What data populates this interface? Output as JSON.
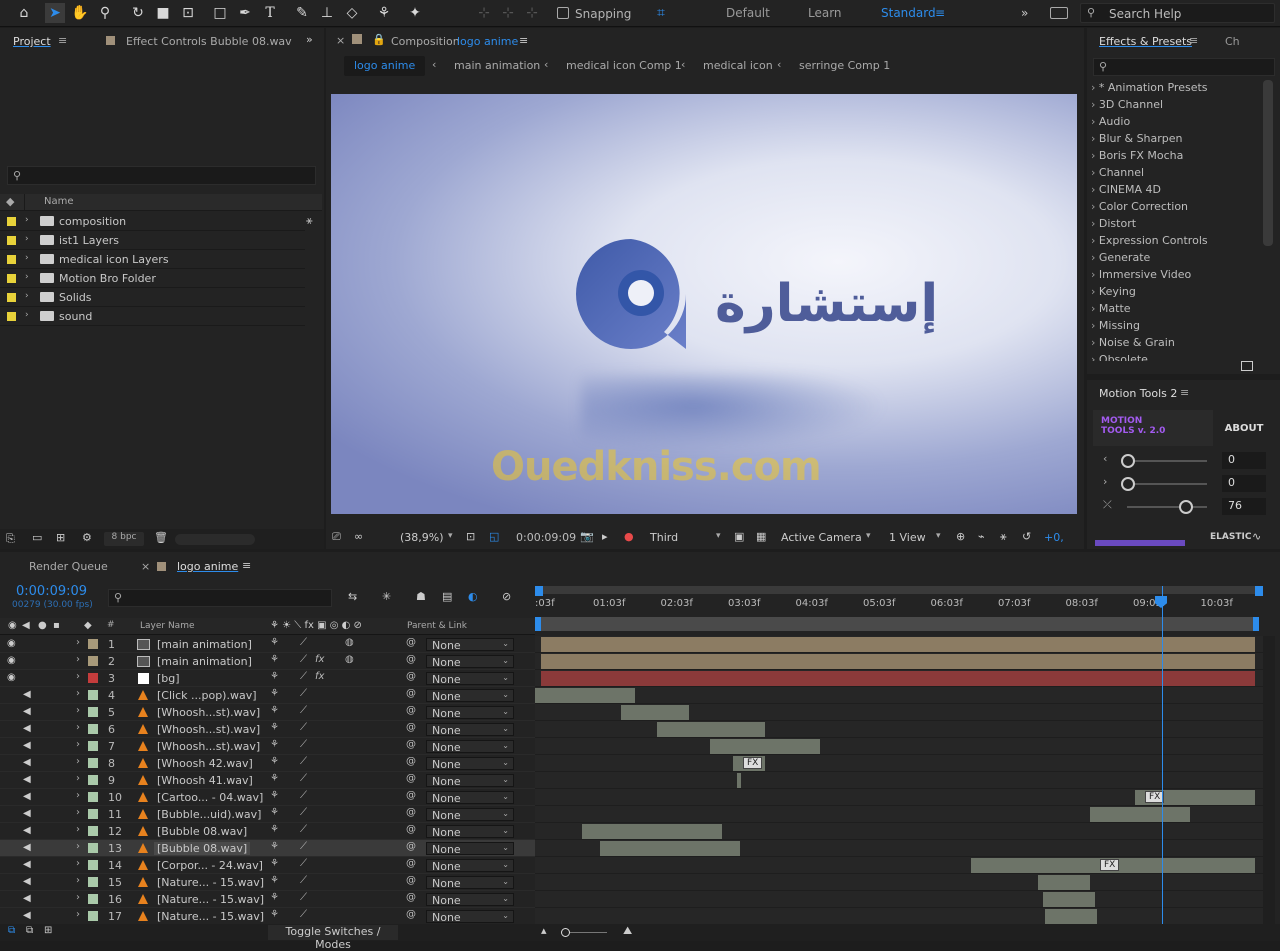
{
  "toolbar": {
    "snapping_label": "Snapping",
    "workspaces": [
      "Default",
      "Learn",
      "Standard"
    ],
    "active_workspace": "Standard",
    "search_placeholder": "Search Help"
  },
  "project_panel": {
    "tab_project": "Project",
    "tab_effect_controls": "Effect Controls  Bubble 08.wav",
    "column_name": "Name",
    "items": [
      {
        "label": "composition",
        "color": "#e8d23a"
      },
      {
        "label": "ist1 Layers",
        "color": "#e8d23a"
      },
      {
        "label": "medical icon Layers",
        "color": "#e8d23a"
      },
      {
        "label": "Motion Bro Folder",
        "color": "#e8d23a"
      },
      {
        "label": "Solids",
        "color": "#e8d23a"
      },
      {
        "label": "sound",
        "color": "#e8d23a"
      }
    ],
    "bpc": "8 bpc"
  },
  "composition": {
    "tab_prefix": "Composition",
    "tab_name": "logo anime",
    "breadcrumbs": [
      "logo anime",
      "main animation",
      "medical icon Comp 1",
      "medical icon",
      "serringe  Comp 1"
    ],
    "logo_text": "إستشارة",
    "watermark": "Ouedkniss.com",
    "zoom": "(38,9%)",
    "timecode": "0:00:09:09",
    "resolution": "Third",
    "camera": "Active Camera",
    "view": "1 View",
    "exposure": "+0,"
  },
  "effects_panel": {
    "tab_effects": "Effects & Presets",
    "tab_char": "Ch",
    "items": [
      "* Animation Presets",
      "3D Channel",
      "Audio",
      "Blur & Sharpen",
      "Boris FX Mocha",
      "Channel",
      "CINEMA 4D",
      "Color Correction",
      "Distort",
      "Expression Controls",
      "Generate",
      "Immersive Video",
      "Keying",
      "Matte",
      "Missing",
      "Noise & Grain",
      "Obsolete"
    ]
  },
  "motion_tools": {
    "title": "Motion Tools 2",
    "logo_line1": "MOTION",
    "logo_line2": "TOOLS v. 2.0",
    "about": "ABOUT",
    "values": [
      "0",
      "0",
      "76"
    ],
    "slider_levels": [
      0,
      0,
      76
    ],
    "elastic": "ELASTIC"
  },
  "timeline": {
    "tab_render": "Render Queue",
    "tab_comp": "logo anime",
    "timecode": "0:00:09:09",
    "frames": "00279 (30.00 fps)",
    "col_num": "#",
    "col_layer": "Layer Name",
    "col_parent": "Parent & Link",
    "ruler": [
      ":03f",
      "01:03f",
      "02:03f",
      "03:03f",
      "04:03f",
      "05:03f",
      "06:03f",
      "07:03f",
      "08:03f",
      "09:03f",
      "10:03f"
    ],
    "toggle_label": "Toggle Switches / Modes",
    "layers": [
      {
        "num": "1",
        "name": "[main animation]",
        "parent": "None",
        "color": "#a89a7a"
      },
      {
        "num": "2",
        "name": "[main animation]",
        "parent": "None",
        "color": "#a89a7a"
      },
      {
        "num": "3",
        "name": "[bg]",
        "parent": "None",
        "color": "#c43c3c"
      },
      {
        "num": "4",
        "name": "[Click ...pop).wav]",
        "parent": "None",
        "color": "#a9c9a9"
      },
      {
        "num": "5",
        "name": "[Whoosh...st).wav]",
        "parent": "None",
        "color": "#a9c9a9"
      },
      {
        "num": "6",
        "name": "[Whoosh...st).wav]",
        "parent": "None",
        "color": "#a9c9a9"
      },
      {
        "num": "7",
        "name": "[Whoosh...st).wav]",
        "parent": "None",
        "color": "#a9c9a9"
      },
      {
        "num": "8",
        "name": "[Whoosh 42.wav]",
        "parent": "None",
        "color": "#a9c9a9"
      },
      {
        "num": "9",
        "name": "[Whoosh 41.wav]",
        "parent": "None",
        "color": "#a9c9a9"
      },
      {
        "num": "10",
        "name": "[Cartoo... - 04.wav]",
        "parent": "None",
        "color": "#a9c9a9"
      },
      {
        "num": "11",
        "name": "[Bubble...uid).wav]",
        "parent": "None",
        "color": "#a9c9a9"
      },
      {
        "num": "12",
        "name": "[Bubble 08.wav]",
        "parent": "None",
        "color": "#a9c9a9"
      },
      {
        "num": "13",
        "name": "[Bubble 08.wav]",
        "parent": "None",
        "color": "#a9c9a9"
      },
      {
        "num": "14",
        "name": "[Corpor... - 24.wav]",
        "parent": "None",
        "color": "#a9c9a9"
      },
      {
        "num": "15",
        "name": "[Nature... - 15.wav]",
        "parent": "None",
        "color": "#a9c9a9"
      },
      {
        "num": "16",
        "name": "[Nature... - 15.wav]",
        "parent": "None",
        "color": "#a9c9a9"
      },
      {
        "num": "17",
        "name": "[Nature... - 15.wav]",
        "parent": "None",
        "color": "#a9c9a9"
      }
    ],
    "fx_label": "FX"
  }
}
